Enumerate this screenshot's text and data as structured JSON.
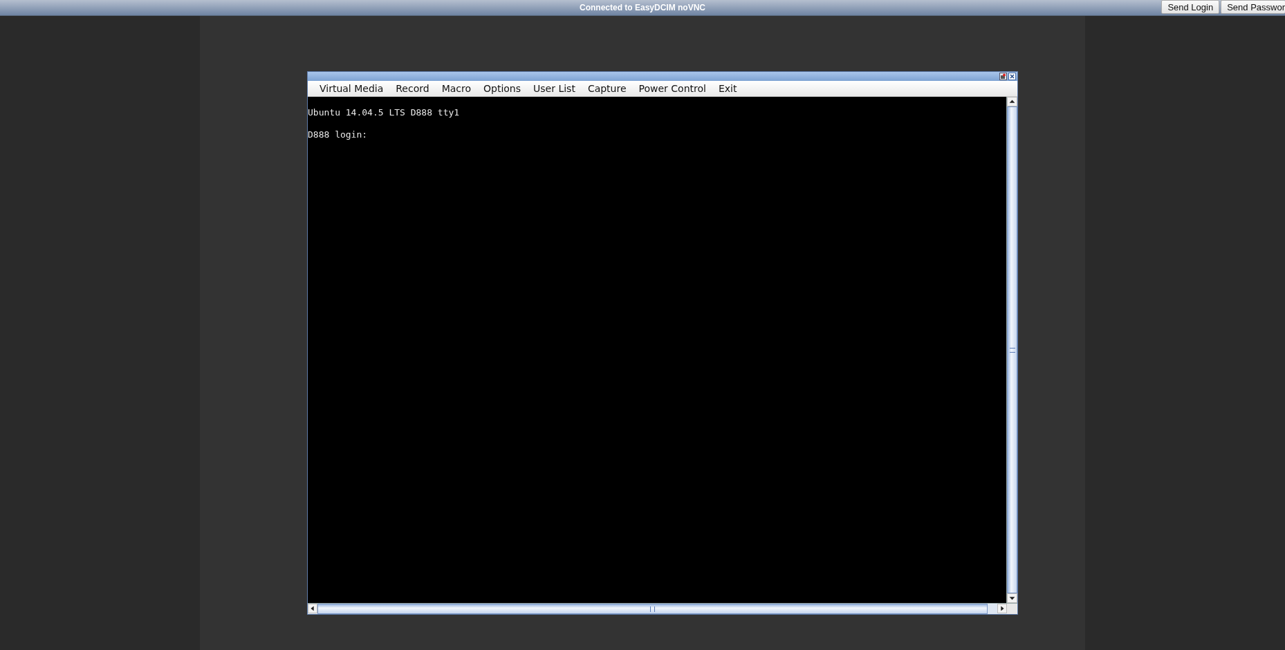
{
  "status_bar": {
    "title": "Connected to EasyDCIM noVNC"
  },
  "buttons": [
    "Send Login",
    "Send Passwor"
  ],
  "menu": [
    "Virtual Media",
    "Record",
    "Macro",
    "Options",
    "User List",
    "Capture",
    "Power Control",
    "Exit"
  ],
  "console": {
    "lines": [
      "Ubuntu 14.04.5 LTS D888 tty1",
      "D888 login:"
    ]
  }
}
